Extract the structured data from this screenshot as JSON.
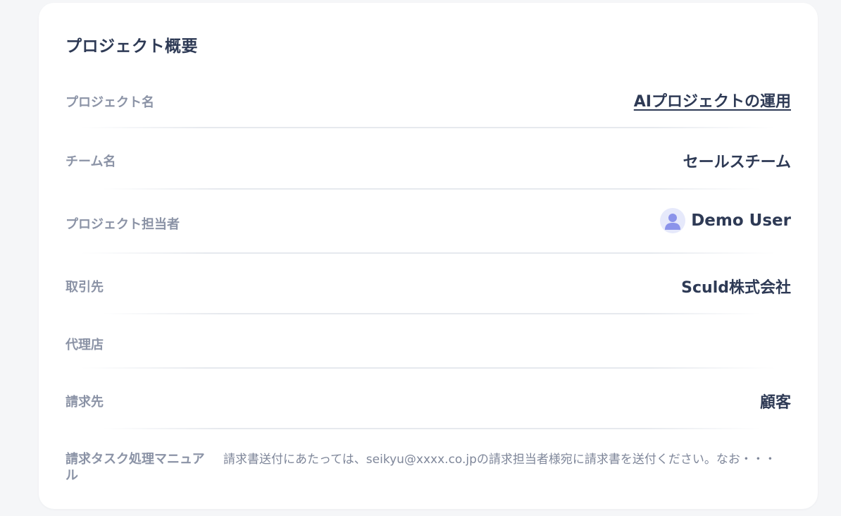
{
  "card": {
    "title": "プロジェクト概要"
  },
  "fields": {
    "project_name": {
      "label": "プロジェクト名",
      "value": "AIプロジェクトの運用"
    },
    "team_name": {
      "label": "チーム名",
      "value": "セールスチーム"
    },
    "owner": {
      "label": "プロジェクト担当者",
      "value": "Demo User",
      "icon": "user-avatar-icon"
    },
    "client": {
      "label": "取引先",
      "value": "Sculd株式会社"
    },
    "agency": {
      "label": "代理店",
      "value": ""
    },
    "billing": {
      "label": "請求先",
      "value": "顧客"
    },
    "manual": {
      "label": "請求タスク処理マニュアル",
      "value": "請求書送付にあたっては、seikyu@xxxx.co.jpの請求担当者様宛に請求書を送付ください。なお・・・"
    }
  },
  "colors": {
    "background": "#f5f6f8",
    "card": "#ffffff",
    "title_text": "#2e3a55",
    "label_text": "#8b93a6",
    "avatar_bg": "#e6e9fb",
    "avatar_icon": "#8b93ea"
  }
}
